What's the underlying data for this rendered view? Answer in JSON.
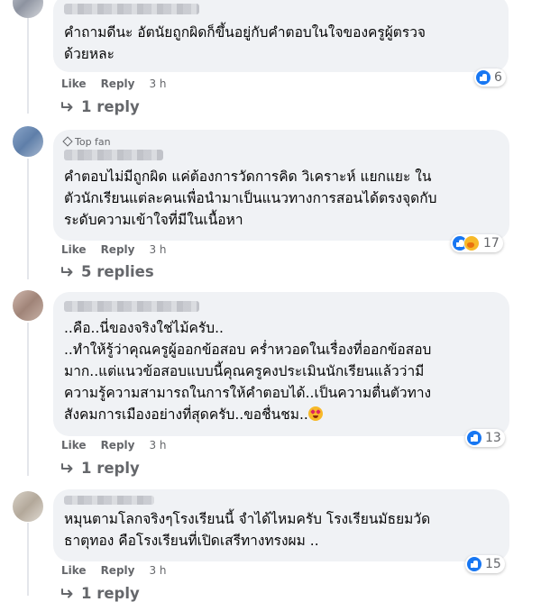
{
  "comments": [
    {
      "top_fan": "",
      "lines": [
        "คำถามดีนะ อัตนัยถูกผิดก็ขึ้นอยู่กับคำตอบในใจของครูผู้ตรวจ",
        "ด้วยหละ"
      ],
      "like_label": "Like",
      "reply_label": "Reply",
      "time": "3 h",
      "reaction_count": "6",
      "replies_label": "1 reply"
    },
    {
      "top_fan": "Top fan",
      "lines": [
        "คำตอบไม่มีถูกผิด แค่ต้องการวัดการคิด วิเคราะห์ แยกแยะ ใน",
        "ตัวนักเรียนแต่ละคนเพื่อนำมาเป็นแนวทางการสอนได้ตรงจุดกับ",
        "ระดับความเข้าใจที่มีในเนื้อหา"
      ],
      "like_label": "Like",
      "reply_label": "Reply",
      "time": "3 h",
      "reaction_count": "17",
      "replies_label": "5 replies"
    },
    {
      "top_fan": "",
      "lines": [
        "..คือ..นี่ของจริงใช่ไม้ครับ..",
        "..ทำให้รู้ว่าคุณครูผู้ออกข้อสอบ คร่ำหวอดในเรื่องที่ออกข้อสอบ",
        "มาก..แต่แนวข้อสอบแบบนี้คุณครูคงประเมินนักเรียนแล้วว่ามี",
        "ความรู้ความสามารถในการให้คำตอบได้..เป็นความตื่นตัวทาง",
        "สังคมการเมืองอย่างที่สุดครับ..ขอชื่นชม.."
      ],
      "like_label": "Like",
      "reply_label": "Reply",
      "time": "3 h",
      "reaction_count": "13",
      "replies_label": "1 reply"
    },
    {
      "top_fan": "",
      "lines": [
        "หมุนตามโลกจริงๆโรงเรียนนี้ จำได้ไหมครับ โรงเรียนมัธยมวัด",
        "ธาตุทอง คือโรงเรียนที่เปิดเสรีทางทรงผม .."
      ],
      "like_label": "Like",
      "reply_label": "Reply",
      "time": "3 h",
      "reaction_count": "15",
      "replies_label": "1 reply"
    }
  ],
  "icons": {
    "like_reaction": "thumbs-up-icon",
    "care_reaction": "care-face-icon",
    "reply_arrow": "reply-arrow-icon",
    "top_fan": "diamond-icon",
    "emoji": "heart-eyes-emoji"
  },
  "colors": {
    "bubble": "#f0f2f5",
    "muted_text": "#65676b",
    "like_blue": "#1877f2"
  }
}
